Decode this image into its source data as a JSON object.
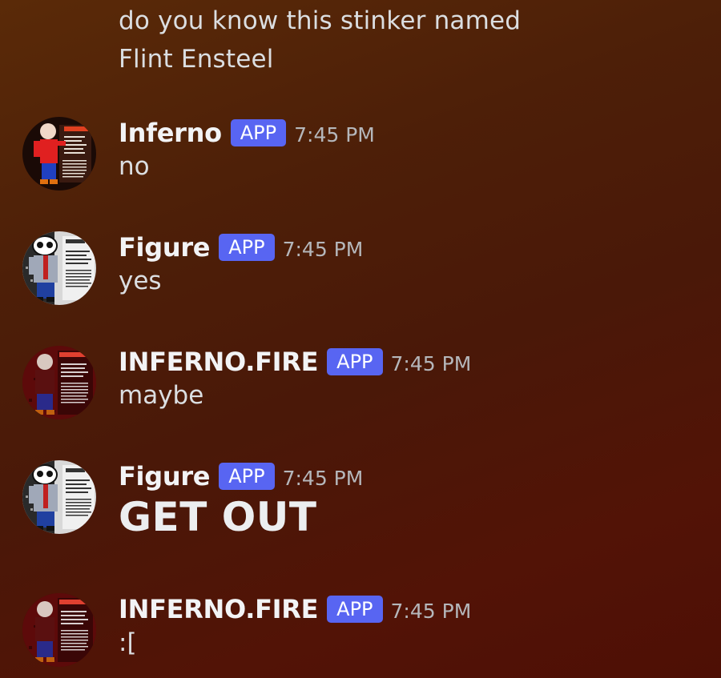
{
  "previous_message": {
    "line1": "do you know this stinker named",
    "line2": "Flint Ensteel"
  },
  "messages": [
    {
      "username": "Inferno",
      "badge": "APP",
      "timestamp": "7:45 PM",
      "content": "no",
      "avatar_icon": "inferno-avatar"
    },
    {
      "username": "Figure",
      "badge": "APP",
      "timestamp": "7:45 PM",
      "content": "yes",
      "avatar_icon": "figure-avatar"
    },
    {
      "username": "INFERNO.FIRE",
      "badge": "APP",
      "timestamp": "7:45 PM",
      "content": "maybe",
      "avatar_icon": "inferno-fire-avatar"
    },
    {
      "username": "Figure",
      "badge": "APP",
      "timestamp": "7:45 PM",
      "content": "GET OUT",
      "avatar_icon": "figure-avatar"
    },
    {
      "username": "INFERNO.FIRE",
      "badge": "APP",
      "timestamp": "7:45 PM",
      "content": ":[",
      "avatar_icon": "inferno-fire-avatar"
    }
  ],
  "colors": {
    "app_badge": "#5865f2",
    "timestamp": "#b5b7bb",
    "message_text": "#dbdee1"
  }
}
